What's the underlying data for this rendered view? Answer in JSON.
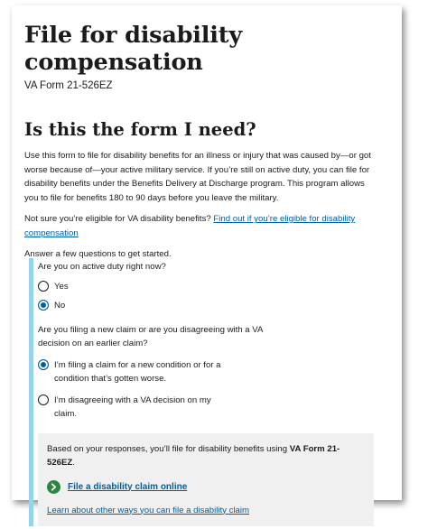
{
  "header": {
    "title": "File for disability compensation",
    "form_number": "VA Form 21-526EZ"
  },
  "intro": {
    "heading": "Is this the form I need?",
    "paragraph1": "Use this form to file for disability benefits for an illness or injury that was caused by—or got worse because of—your active military service. If you’re still on active duty, you can file for disability benefits under the Benefits Delivery at Discharge program. This program allows you to file for benefits 180 to 90 days before you leave the military.",
    "eligibility_prefix": "Not sure you’re eligible for VA disability benefits?",
    "eligibility_link": "Find out if you’re eligible for disability compensation",
    "start_text": "Answer a few questions to get started."
  },
  "wizard": {
    "q1": {
      "label": "Are you on active duty right now?",
      "options": [
        "Yes",
        "No"
      ],
      "selected": "No"
    },
    "q2": {
      "label": "Are you filing a new claim or are you disagreeing with a VA decision on an earlier claim?",
      "options": [
        "I’m filing a claim for a new condition or for a condition that’s gotten worse.",
        "I’m disagreeing with a VA decision on my claim."
      ],
      "selected": "I’m filing a claim for a new condition or for a condition that’s gotten worse."
    },
    "result": {
      "text_prefix": "Based on your responses, you’ll file for disability benefits using",
      "form_name": "VA Form 21-526EZ",
      "text_suffix": ".",
      "action_label": "File a disability claim online",
      "other_link": "Learn about other ways you can file a disability claim"
    }
  },
  "colors": {
    "link": "#005ea2",
    "accent_border": "#97d4ea",
    "action_green": "#2e8540",
    "result_bg": "#f0f0f0"
  },
  "icons": {
    "action": "chevron-right-circle-icon"
  }
}
